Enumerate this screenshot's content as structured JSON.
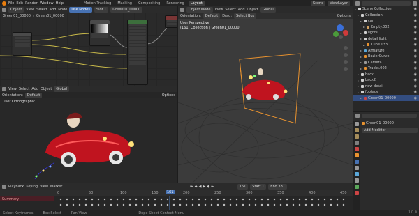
{
  "topbar": {
    "menus": [
      "File",
      "Edit",
      "Render",
      "Window",
      "Help"
    ],
    "workspaces": [
      "Motion Tracking",
      "Masking",
      "Compositing",
      "Rendering",
      "Layout"
    ],
    "active_workspace": "Layout",
    "scene": "Scene",
    "view_layer": "ViewLayer"
  },
  "node_editor": {
    "header_type": "Object",
    "menus": [
      "View",
      "Select",
      "Add",
      "Node"
    ],
    "use_nodes_label": "Use Nodes",
    "slot": "Slot 1",
    "material": "Green01_00000",
    "breadcrumb_object": "Green01_00000",
    "breadcrumb_material": "Green01_00000"
  },
  "image_editor": {
    "menus": [
      "View",
      "Select",
      "Add",
      "Object"
    ],
    "orientation_label": "Orientation:",
    "orientation_value": "Global",
    "viewport_label": "User Orthographic",
    "options_label": "Options"
  },
  "viewport": {
    "mode": "Object Mode",
    "menus": [
      "View",
      "Select",
      "Add",
      "Object"
    ],
    "transform": "Global",
    "orientation_label": "Orientation:",
    "orientation_value": "Default",
    "drag_label": "Drag:",
    "drag_value": "Select Box",
    "options_label": "Options",
    "perspective": "User Perspective",
    "collection_info": "(161) Collection | Green01_00000",
    "accent_color": "#e8922f"
  },
  "outliner": {
    "rows": [
      {
        "label": "Scene Collection",
        "indent": 0,
        "icon": "box"
      },
      {
        "label": "Collection",
        "indent": 1,
        "icon": "box"
      },
      {
        "label": "car",
        "indent": 2,
        "icon": "box"
      },
      {
        "label": "Empty.002",
        "indent": 3,
        "icon": "empty"
      },
      {
        "label": "lights",
        "indent": 2,
        "icon": "box"
      },
      {
        "label": "detail light",
        "indent": 2,
        "icon": "box"
      },
      {
        "label": "Cube.033",
        "indent": 3,
        "icon": "mesh"
      },
      {
        "label": "Armature",
        "indent": 2,
        "icon": "arm"
      },
      {
        "label": "BezierCurve",
        "indent": 2,
        "icon": "curve"
      },
      {
        "label": "Camera",
        "indent": 2,
        "icon": "cam"
      },
      {
        "label": "Tracks.002",
        "indent": 2,
        "icon": "mesh"
      },
      {
        "label": "back",
        "indent": 1,
        "icon": "box"
      },
      {
        "label": "back2",
        "indent": 1,
        "icon": "box"
      },
      {
        "label": "new detail",
        "indent": 1,
        "icon": "box"
      },
      {
        "label": "footage",
        "indent": 1,
        "icon": "box"
      },
      {
        "label": "Green01_00000",
        "indent": 2,
        "icon": "img"
      }
    ],
    "selected_label": "Green01_00000"
  },
  "properties": {
    "search_label": "Green01_00000",
    "add_modifier_label": "Add Modifier"
  },
  "timeline": {
    "menus": [
      "Playback",
      "Keying",
      "View",
      "Marker"
    ],
    "current_frame": "161",
    "start_label": "Start",
    "start_value": "1",
    "end_label": "End",
    "end_value": "381",
    "ticks": [
      "0",
      "50",
      "100",
      "150",
      "200",
      "250",
      "300",
      "350",
      "400",
      "450"
    ],
    "summary_label": "Summary"
  },
  "statusbar": {
    "items": [
      "Select Keyframes",
      "Box Select",
      "Pan View",
      "Dope Sheet Context Menu"
    ],
    "version": "3.0.0"
  }
}
